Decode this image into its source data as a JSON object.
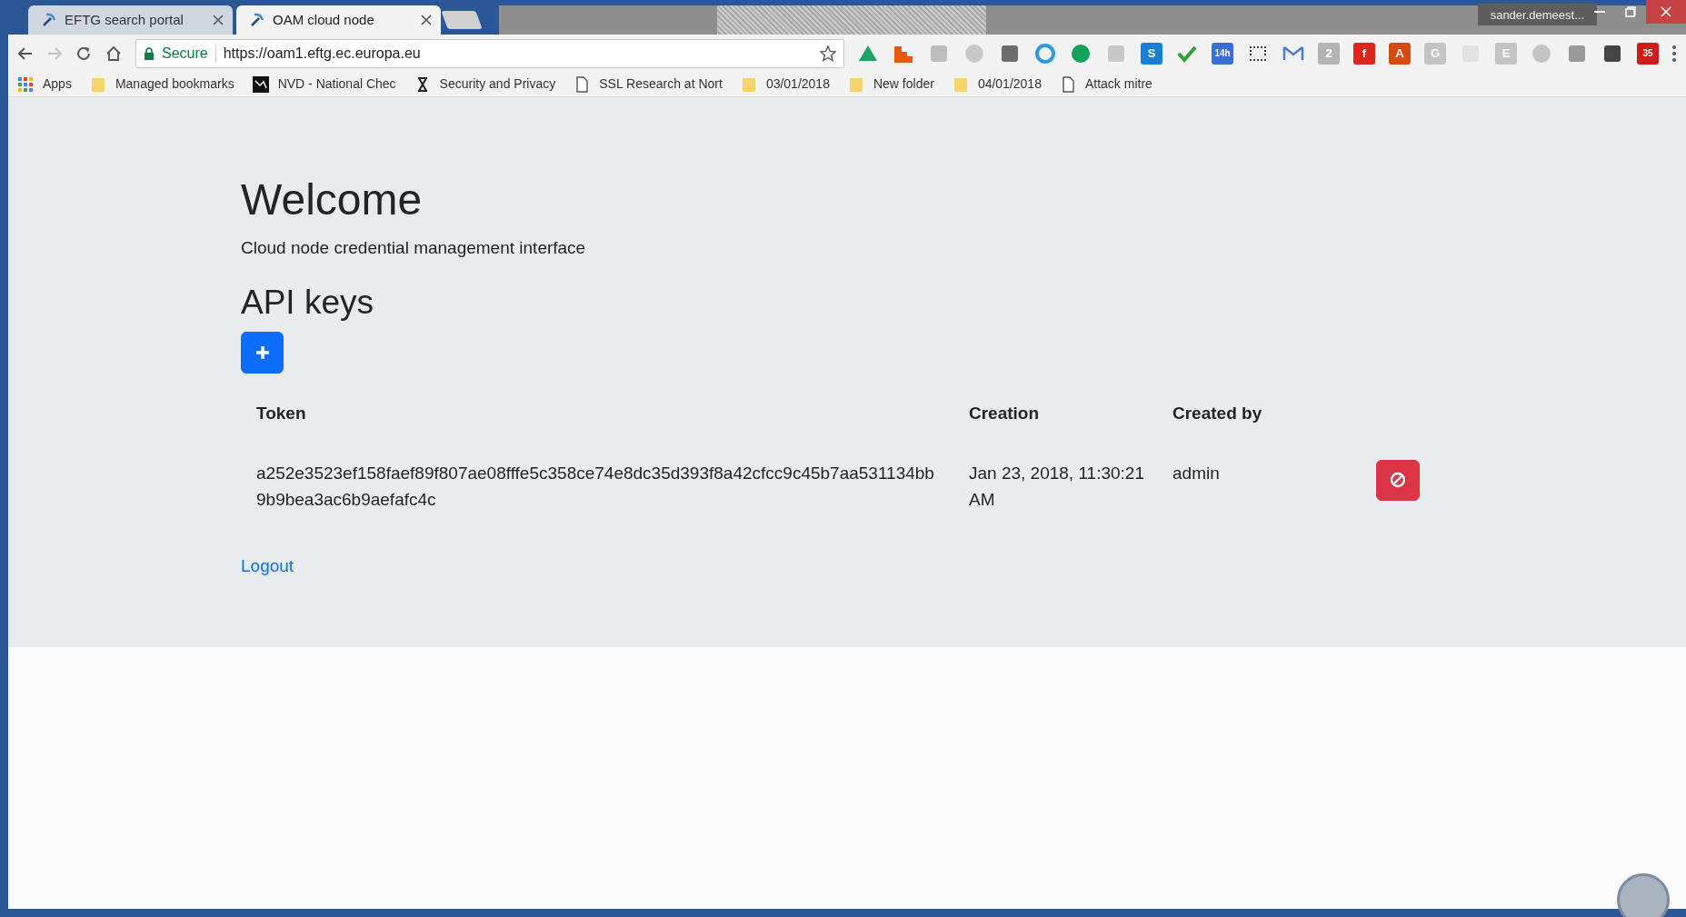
{
  "tabs": [
    {
      "title": "EFTG search portal",
      "selected": false
    },
    {
      "title": "OAM cloud node",
      "selected": true
    }
  ],
  "profile": {
    "name": "sander.demeest..."
  },
  "toolbar": {
    "forward_disabled": true,
    "secure_label": "Secure",
    "url": "https://oam1.eftg.ec.europa.eu",
    "bookmarked": false
  },
  "extensions": [
    {
      "kind": "tri",
      "color": "#1ea362"
    },
    {
      "kind": "bars",
      "color": "#e8590c"
    },
    {
      "kind": "square",
      "color": "#bdbdbd"
    },
    {
      "kind": "circle",
      "color": "#c8c8c8"
    },
    {
      "kind": "square",
      "color": "#6d6d6d"
    },
    {
      "kind": "ring",
      "color": "#2f9ae0"
    },
    {
      "kind": "circle",
      "color": "#11a35a"
    },
    {
      "kind": "square",
      "color": "#c8c8c8"
    },
    {
      "kind": "glyph",
      "text": "S",
      "color": "#1a7fd6"
    },
    {
      "kind": "check",
      "color": "#2e9e3e"
    },
    {
      "kind": "glyph",
      "text": "14h",
      "color": "#3a6fd8"
    },
    {
      "kind": "dashed",
      "color": "#444444"
    },
    {
      "kind": "mail",
      "color": "#4a7bd0"
    },
    {
      "kind": "glyph",
      "text": "2",
      "color": "#b3b3b3"
    },
    {
      "kind": "glyph",
      "text": "f",
      "color": "#e0261c"
    },
    {
      "kind": "glyph",
      "text": "A",
      "color": "#d9480f"
    },
    {
      "kind": "glyph",
      "text": "G",
      "color": "#c4c4c4"
    },
    {
      "kind": "square",
      "color": "#e2e2e2"
    },
    {
      "kind": "glyph",
      "text": "E",
      "color": "#c4c4c4"
    },
    {
      "kind": "circle",
      "color": "#c4c4c4"
    },
    {
      "kind": "square",
      "color": "#9a9a9a"
    },
    {
      "kind": "square",
      "color": "#444444"
    },
    {
      "kind": "glyph",
      "text": "35",
      "color": "#d01b1b"
    }
  ],
  "bookmarks": [
    {
      "kind": "apps",
      "label": "Apps"
    },
    {
      "kind": "folder",
      "label": "Managed bookmarks"
    },
    {
      "kind": "site",
      "label": "NVD - National Chec"
    },
    {
      "kind": "hourglass",
      "label": "Security and Privacy"
    },
    {
      "kind": "page",
      "label": "SSL Research at Nort"
    },
    {
      "kind": "folder",
      "label": "03/01/2018"
    },
    {
      "kind": "folder",
      "label": "New folder"
    },
    {
      "kind": "folder",
      "label": "04/01/2018"
    },
    {
      "kind": "page",
      "label": "Attack mitre"
    }
  ],
  "page": {
    "title": "Welcome",
    "subtitle": "Cloud node credential management interface",
    "section": "API keys",
    "table": {
      "columns": [
        "Token",
        "Creation",
        "Created by"
      ],
      "rows": [
        {
          "token": "a252e3523ef158faef89f807ae08fffe5c358ce74e8dc35d393f8a42cfcc9c45b7aa531134bb9b9bea3ac6b9aefafc4c",
          "creation": "Jan 23, 2018, 11:30:21 AM",
          "created_by": "admin"
        }
      ]
    },
    "logout": "Logout"
  }
}
